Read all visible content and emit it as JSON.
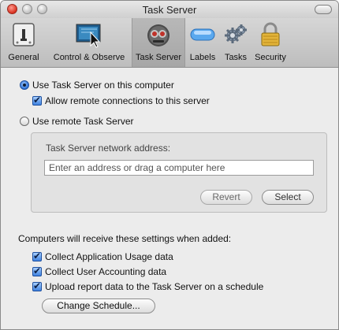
{
  "window": {
    "title": "Task Server"
  },
  "toolbar": {
    "items": [
      {
        "label": "General",
        "icon": "general-icon"
      },
      {
        "label": "Control & Observe",
        "icon": "control-observe-icon"
      },
      {
        "label": "Task Server",
        "icon": "task-server-icon",
        "selected": true
      },
      {
        "label": "Labels",
        "icon": "labels-icon"
      },
      {
        "label": "Tasks",
        "icon": "tasks-icon"
      },
      {
        "label": "Security",
        "icon": "security-icon"
      }
    ]
  },
  "server_options": {
    "use_local": {
      "label": "Use Task Server on this computer",
      "selected": true
    },
    "allow_remote": {
      "label": "Allow remote connections to this server",
      "checked": true
    },
    "use_remote": {
      "label": "Use remote Task Server",
      "selected": false
    }
  },
  "remote_group": {
    "address_label": "Task Server network address:",
    "address_placeholder": "Enter an address or drag a computer here",
    "revert_button": "Revert",
    "select_button": "Select"
  },
  "defaults": {
    "heading": "Computers will receive these settings when added:",
    "collect_usage": {
      "label": "Collect Application Usage data",
      "checked": true
    },
    "collect_accounting": {
      "label": "Collect User Accounting data",
      "checked": true
    },
    "upload_reports": {
      "label": "Upload report data to the Task Server on a schedule",
      "checked": true
    },
    "change_schedule_button": "Change Schedule..."
  },
  "colors": {
    "accent": "#3f82e0",
    "window_bg": "#ececec"
  }
}
